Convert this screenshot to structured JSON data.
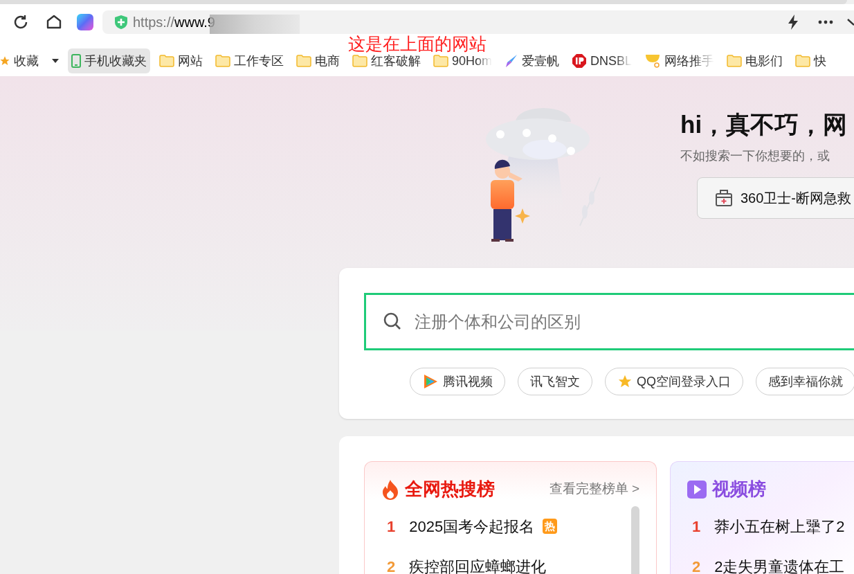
{
  "browser": {
    "url_scheme": "https://",
    "url_host": "www.9",
    "annotation": "这是在上面的网站"
  },
  "bookmarks": [
    {
      "kind": "star",
      "label": "收藏",
      "selected": false,
      "faded": false
    },
    {
      "kind": "phone",
      "label": "手机收藏夹",
      "selected": true,
      "faded": false
    },
    {
      "kind": "folder",
      "label": "网站",
      "selected": false,
      "faded": false
    },
    {
      "kind": "folder",
      "label": "工作专区",
      "selected": false,
      "faded": false
    },
    {
      "kind": "folder",
      "label": "电商",
      "selected": false,
      "faded": false
    },
    {
      "kind": "folder",
      "label": "红客破解",
      "selected": false,
      "faded": false
    },
    {
      "kind": "folder",
      "label": "90Hom",
      "selected": false,
      "faded": true
    },
    {
      "kind": "kite",
      "label": "爱壹帆",
      "selected": false,
      "faded": false
    },
    {
      "kind": "ip",
      "label": "DNSBL",
      "selected": false,
      "faded": true
    },
    {
      "kind": "cup",
      "label": "网络推手",
      "selected": false,
      "faded": true
    },
    {
      "kind": "folder",
      "label": "电影们",
      "selected": false,
      "faded": false
    },
    {
      "kind": "folder",
      "label": "快",
      "selected": false,
      "faded": false
    }
  ],
  "hero": {
    "title": "hi，真不巧，网",
    "subtitle": "不如搜索一下你想要的，或",
    "action": "360卫士-断网急救"
  },
  "search": {
    "placeholder": "注册个体和公司的区别"
  },
  "chips": [
    {
      "kind": "video",
      "label": "腾讯视频"
    },
    {
      "kind": "plain",
      "label": "讯飞智文"
    },
    {
      "kind": "star",
      "label": "QQ空间登录入口"
    },
    {
      "kind": "plain",
      "label": "感到幸福你就"
    }
  ],
  "hot": {
    "title": "全网热搜榜",
    "more": "查看完整榜单 >",
    "rows": [
      {
        "rank": "1",
        "color": "#e8412e",
        "title": "2025国考今起报名",
        "badge": "热"
      },
      {
        "rank": "2",
        "color": "#f29a38",
        "title": "疾控部回应蟑螂进化"
      }
    ]
  },
  "video": {
    "title": "视频榜",
    "rows": [
      {
        "rank": "1",
        "color": "#e8412e",
        "title": "莽小五在树上犟了2"
      },
      {
        "rank": "2",
        "color": "#f29a38",
        "title": "2走失男童遗体在工"
      }
    ]
  }
}
